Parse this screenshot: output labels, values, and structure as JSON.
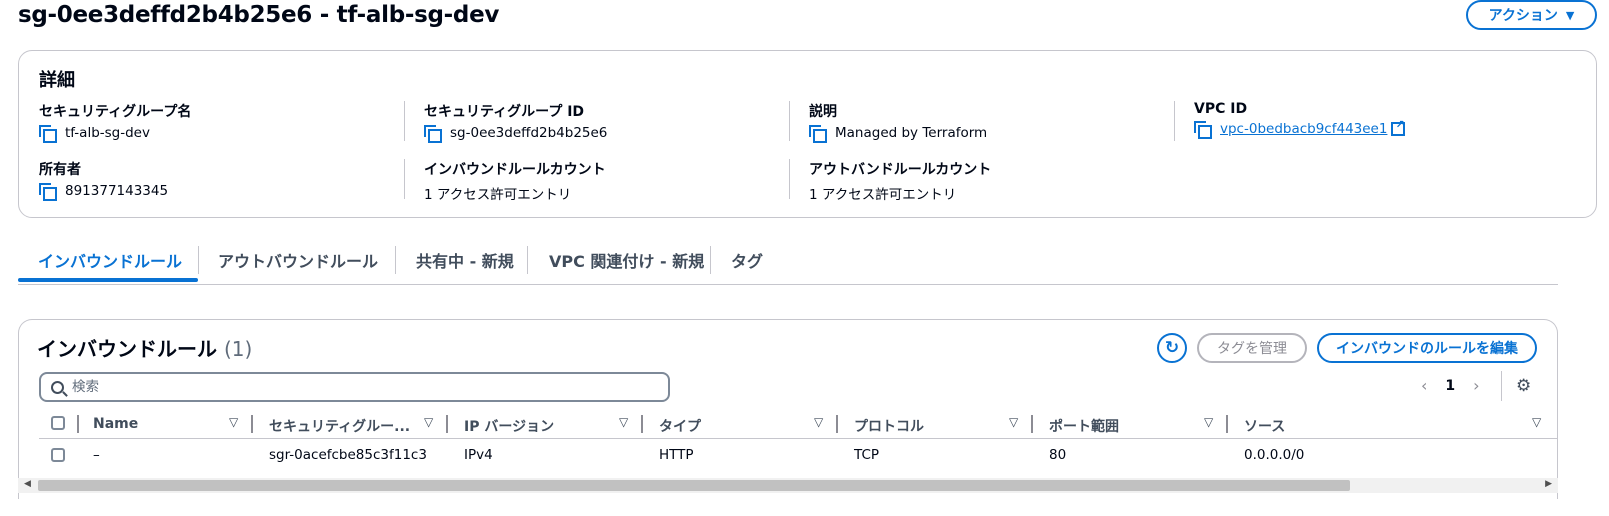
{
  "page": {
    "title": "sg-0ee3deffd2b4b25e6 - tf-alb-sg-dev",
    "action_label": "アクション",
    "action_caret": "▼"
  },
  "details": {
    "heading": "詳細",
    "sg_name": {
      "label": "セキュリティグループ名",
      "value": "tf-alb-sg-dev"
    },
    "sg_id": {
      "label": "セキュリティグループ ID",
      "value": "sg-0ee3deffd2b4b25e6"
    },
    "description": {
      "label": "説明",
      "value": "Managed by Terraform"
    },
    "vpc_id": {
      "label": "VPC ID",
      "value": "vpc-0bedbacb9cf443ee1"
    },
    "owner": {
      "label": "所有者",
      "value": "891377143345"
    },
    "inbound_count": {
      "label": "インバウンドルールカウント",
      "value": "1 アクセス許可エントリ"
    },
    "outbound_count": {
      "label": "アウトバンドルールカウント",
      "value": "1 アクセス許可エントリ"
    }
  },
  "tabs": [
    {
      "label": "インバウンドルール",
      "active": true
    },
    {
      "label": "アウトバウンドルール",
      "active": false
    },
    {
      "label": "共有中 - 新規",
      "active": false
    },
    {
      "label": "VPC 関連付け - 新規",
      "active": false
    },
    {
      "label": "タグ",
      "active": false
    }
  ],
  "rules": {
    "title": "インバウンドルール",
    "count": "(1)",
    "refresh_icon": "↻",
    "manage_tags_label": "タグを管理",
    "edit_label": "インバウンドのルールを編集",
    "search_placeholder": "検索",
    "pager": {
      "prev": "‹",
      "page": "1",
      "next": "›"
    },
    "settings_icon": "⚙",
    "columns": [
      "Name",
      "セキュリティグルー...",
      "IP バージョン",
      "タイプ",
      "プロトコル",
      "ポート範囲",
      "ソース"
    ],
    "sort_icon": "▽",
    "rows": [
      [
        "–",
        "sgr-0acefcbe85c3f11c3",
        "IPv4",
        "HTTP",
        "TCP",
        "80",
        "0.0.0.0/0"
      ]
    ]
  },
  "scrollbar": {
    "left_arrow": "◀",
    "right_arrow": "▶"
  },
  "colors": {
    "accent": "#0972d3",
    "border": "#c6c6cd",
    "text": "#000716"
  }
}
